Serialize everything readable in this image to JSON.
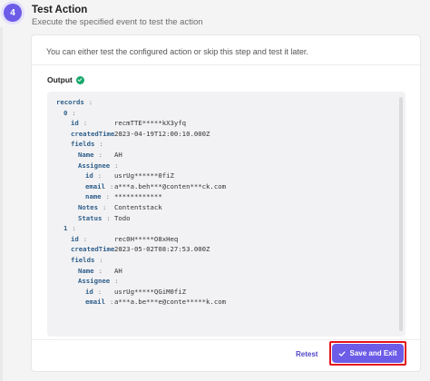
{
  "step": {
    "number": "4",
    "title": "Test Action",
    "subtitle": "Execute the specified event to test the action"
  },
  "card": {
    "info_text": "You can either test the configured action or skip this step and test it later.",
    "output_label": "Output",
    "output_status_icon": "check-circle-icon",
    "output_status_color": "#17a96b"
  },
  "code": {
    "lines": [
      {
        "key": "records",
        "value": ""
      },
      {
        "key": "0",
        "value": ""
      },
      {
        "key": "id",
        "value": "recmTTE*****kX3yfq"
      },
      {
        "key": "createdTime",
        "value": "2023-04-19T12:00:10.000Z"
      },
      {
        "key": "fields",
        "value": ""
      },
      {
        "key": "Name",
        "value": "AH"
      },
      {
        "key": "Assignee",
        "value": ""
      },
      {
        "key": "id",
        "value": "usrUg******0fiZ"
      },
      {
        "key": "email",
        "value": "a***a.beh***@conten***ck.com"
      },
      {
        "key": "name",
        "value": "************"
      },
      {
        "key": "Notes",
        "value": "Contentstack"
      },
      {
        "key": "Status",
        "value": "Todo"
      },
      {
        "key": "1",
        "value": ""
      },
      {
        "key": "id",
        "value": "rec0H*****O8xHeq"
      },
      {
        "key": "createdTime",
        "value": "2023-05-02T08:27:53.000Z"
      },
      {
        "key": "fields",
        "value": ""
      },
      {
        "key": "Name",
        "value": "AH"
      },
      {
        "key": "Assignee",
        "value": ""
      },
      {
        "key": "id",
        "value": "usrUg*****QGiM0fiZ"
      },
      {
        "key": "email",
        "value": "a***a.be***e@conte*****k.com"
      }
    ]
  },
  "footer": {
    "retest_label": "Retest",
    "save_label": "Save and Exit"
  },
  "colors": {
    "accent": "#6c5ce7",
    "highlight": "#e4131b"
  }
}
